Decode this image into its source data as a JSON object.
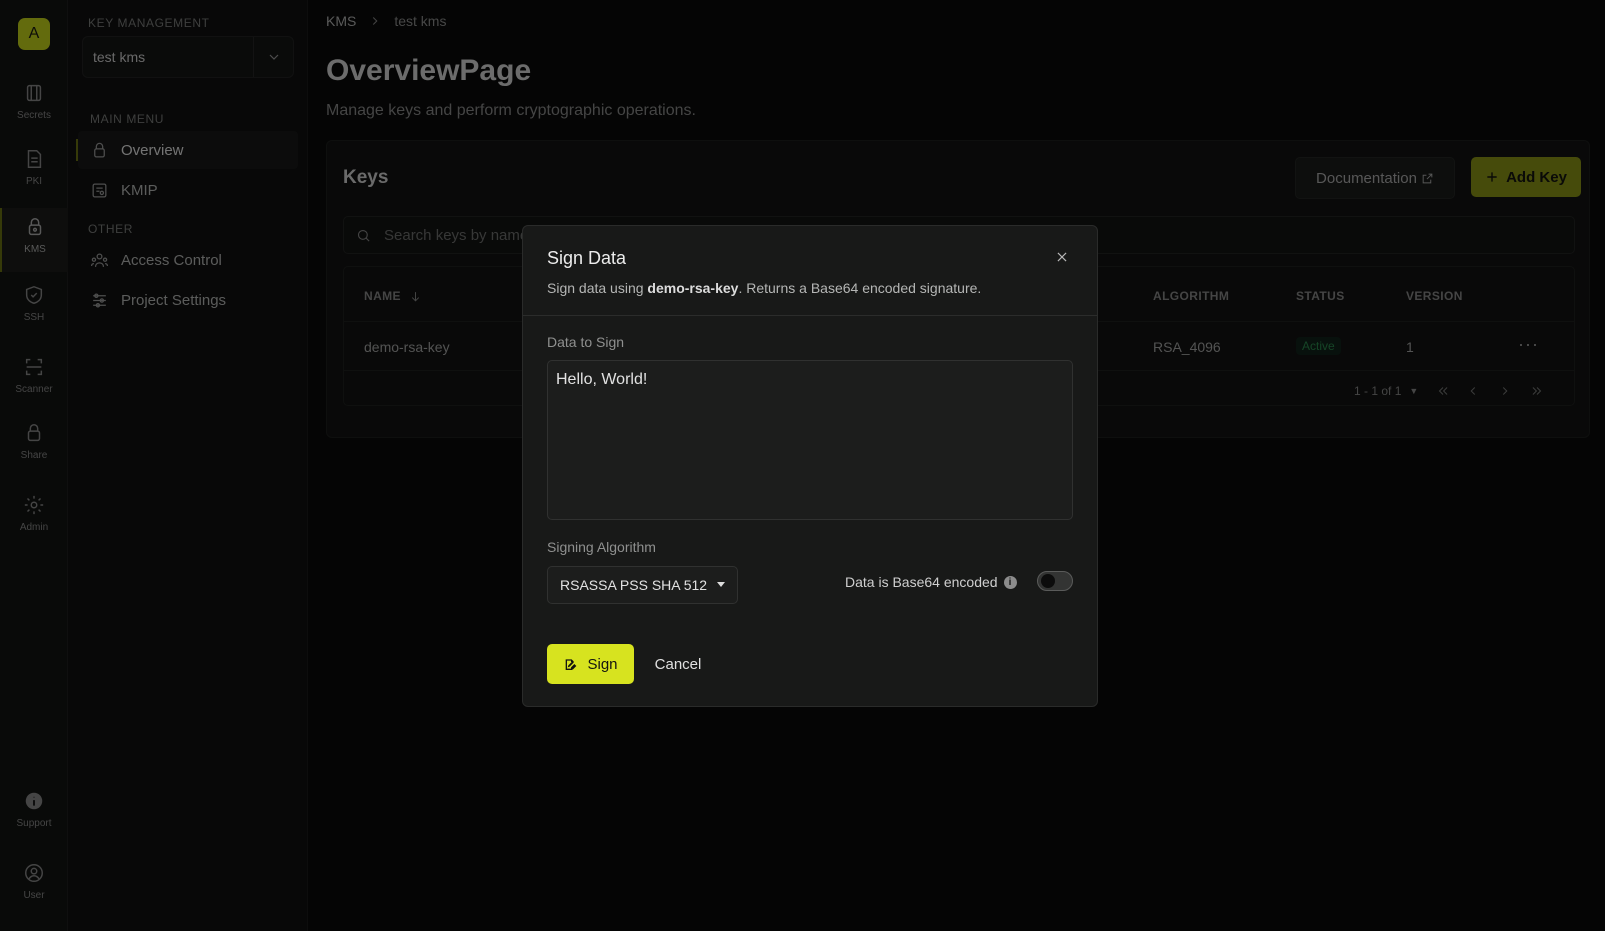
{
  "org": {
    "initial": "A"
  },
  "rail": [
    {
      "label": "Secrets",
      "icon": "secrets-icon"
    },
    {
      "label": "PKI",
      "icon": "pki-icon"
    },
    {
      "label": "KMS",
      "icon": "kms-icon"
    },
    {
      "label": "SSH",
      "icon": "ssh-icon"
    },
    {
      "label": "Scanner",
      "icon": "scanner-icon"
    },
    {
      "label": "Share",
      "icon": "share-icon"
    },
    {
      "label": "Admin",
      "icon": "gear-icon"
    },
    {
      "label": "Support",
      "icon": "info-icon"
    },
    {
      "label": "User",
      "icon": "user-icon"
    }
  ],
  "sidenav": {
    "section_title": "KEY MANAGEMENT",
    "project": "test kms",
    "main_menu_label": "MAIN MENU",
    "other_label": "OTHER",
    "items": [
      {
        "label": "Overview"
      },
      {
        "label": "KMIP"
      },
      {
        "label": "Access Control"
      },
      {
        "label": "Project Settings"
      }
    ]
  },
  "breadcrumb": {
    "root": "KMS",
    "current": "test kms"
  },
  "page": {
    "title": "OverviewPage",
    "subtitle": "Manage keys and perform cryptographic operations."
  },
  "keys_card": {
    "title": "Keys",
    "documentation_label": "Documentation",
    "add_key_label": "Add Key",
    "search_placeholder": "Search keys by name...",
    "columns": {
      "name": "NAME",
      "algorithm": "ALGORITHM",
      "status": "STATUS",
      "version": "VERSION"
    },
    "rows": [
      {
        "name": "demo-rsa-key",
        "algorithm": "RSA_4096",
        "status": "Active",
        "version": "1"
      }
    ],
    "pagination": "1 - 1 of 1"
  },
  "modal": {
    "title": "Sign Data",
    "desc_prefix": "Sign data using ",
    "desc_key": "demo-rsa-key",
    "desc_suffix": ". Returns a Base64 encoded signature.",
    "data_label": "Data to Sign",
    "data_value": "Hello, World!",
    "algorithm_label": "Signing Algorithm",
    "algorithm_value": "RSASSA PSS SHA 512",
    "base64_label": "Data is Base64 encoded",
    "base64_enabled": false,
    "sign_label": "Sign",
    "cancel_label": "Cancel"
  },
  "colors": {
    "accent": "#d7e31f",
    "accent_dim": "#8c9716",
    "status_active": "#2b8a4d"
  }
}
